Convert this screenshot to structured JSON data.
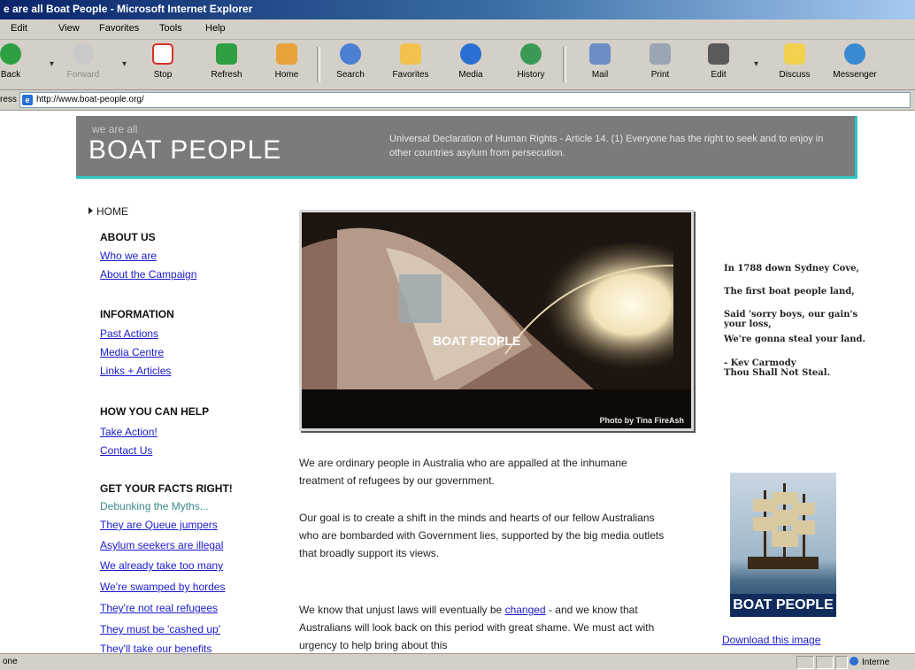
{
  "window": {
    "title": "e are all Boat People - Microsoft Internet Explorer"
  },
  "menu": [
    "Edit",
    "View",
    "Favorites",
    "Tools",
    "Help"
  ],
  "toolbar": [
    {
      "name": "back",
      "label": "Back",
      "icon": "back-arrow-icon",
      "color": "#2ea043"
    },
    {
      "name": "forward",
      "label": "Forward",
      "icon": "forward-arrow-icon",
      "color": "#b5b5b5"
    },
    {
      "name": "stop",
      "label": "Stop",
      "icon": "stop-icon",
      "color": "#d93025"
    },
    {
      "name": "refresh",
      "label": "Refresh",
      "icon": "refresh-icon",
      "color": "#2ea043"
    },
    {
      "name": "home",
      "label": "Home",
      "icon": "home-icon",
      "color": "#e8a23c"
    },
    {
      "name": "search",
      "label": "Search",
      "icon": "search-icon",
      "color": "#4a7fd1"
    },
    {
      "name": "favorites",
      "label": "Favorites",
      "icon": "star-icon",
      "color": "#f2c14e"
    },
    {
      "name": "media",
      "label": "Media",
      "icon": "media-icon",
      "color": "#2a6fd1"
    },
    {
      "name": "history",
      "label": "History",
      "icon": "history-icon",
      "color": "#3a9a55"
    },
    {
      "name": "mail",
      "label": "Mail",
      "icon": "mail-icon",
      "color": "#6b8fc4"
    },
    {
      "name": "print",
      "label": "Print",
      "icon": "printer-icon",
      "color": "#9aa6b2"
    },
    {
      "name": "edit",
      "label": "Edit",
      "icon": "edit-icon",
      "color": "#5a5a5a"
    },
    {
      "name": "discuss",
      "label": "Discuss",
      "icon": "discuss-icon",
      "color": "#f2d24e"
    },
    {
      "name": "messenger",
      "label": "Messenger",
      "icon": "messenger-icon",
      "color": "#3a8ad1"
    }
  ],
  "address": {
    "label": "ress",
    "url": "http://www.boat-people.org/"
  },
  "banner": {
    "small": "we are all",
    "big": "BOAT PEOPLE",
    "quote": "Universal Declaration of Human Rights - Article 14. (1) Everyone has the right to seek and to enjoy in other countries asylum from persecution."
  },
  "nav": {
    "home": "HOME",
    "about_head": "ABOUT US",
    "about_links": [
      "Who we are",
      "About the Campaign"
    ],
    "info_head": "INFORMATION",
    "info_links": [
      "Past Actions",
      "Media Centre",
      "Links + Articles"
    ],
    "help_head": "HOW YOU CAN HELP",
    "help_links": [
      "Take Action!",
      "Contact Us"
    ],
    "facts_head": "GET YOUR FACTS RIGHT!",
    "facts_sub": "Debunking the Myths...",
    "facts_links": [
      "They are Queue jumpers",
      "Asylum seekers are illegal",
      "We already take too many",
      "We're swamped by hordes",
      "They're not real refugees",
      "They must be 'cashed up'",
      "They'll take our benefits"
    ]
  },
  "hero": {
    "overlay": "BOAT PEOPLE",
    "caption": "Photo by Tina FireAsh"
  },
  "main": {
    "p1": "We are ordinary people in Australia who are appalled at the inhumane treatment of refugees by our government.",
    "p2": "Our goal is to create a shift in the minds and hearts of our fellow Australians who are bombarded with Government lies, supported by the big media outlets that broadly support its views.",
    "p3_before": "We know that unjust laws will eventually be ",
    "p3_link": "changed",
    "p3_after": " - and we know that Australians will look back on this period with great shame. We must act with urgency to help bring about this"
  },
  "poem": {
    "l1": "In 1788 down Sydney Cove,",
    "l2": "The first boat people land,",
    "l3": "Said 'sorry boys, our gain's your loss,",
    "l4": "We're gonna steal your land.",
    "l5": "- Kev Carmody",
    "l6": "Thou Shall Not Steal."
  },
  "poster": {
    "title": "BOAT PEOPLE",
    "download": "Download this image"
  },
  "status": {
    "text": "one",
    "zone": "Interne"
  }
}
